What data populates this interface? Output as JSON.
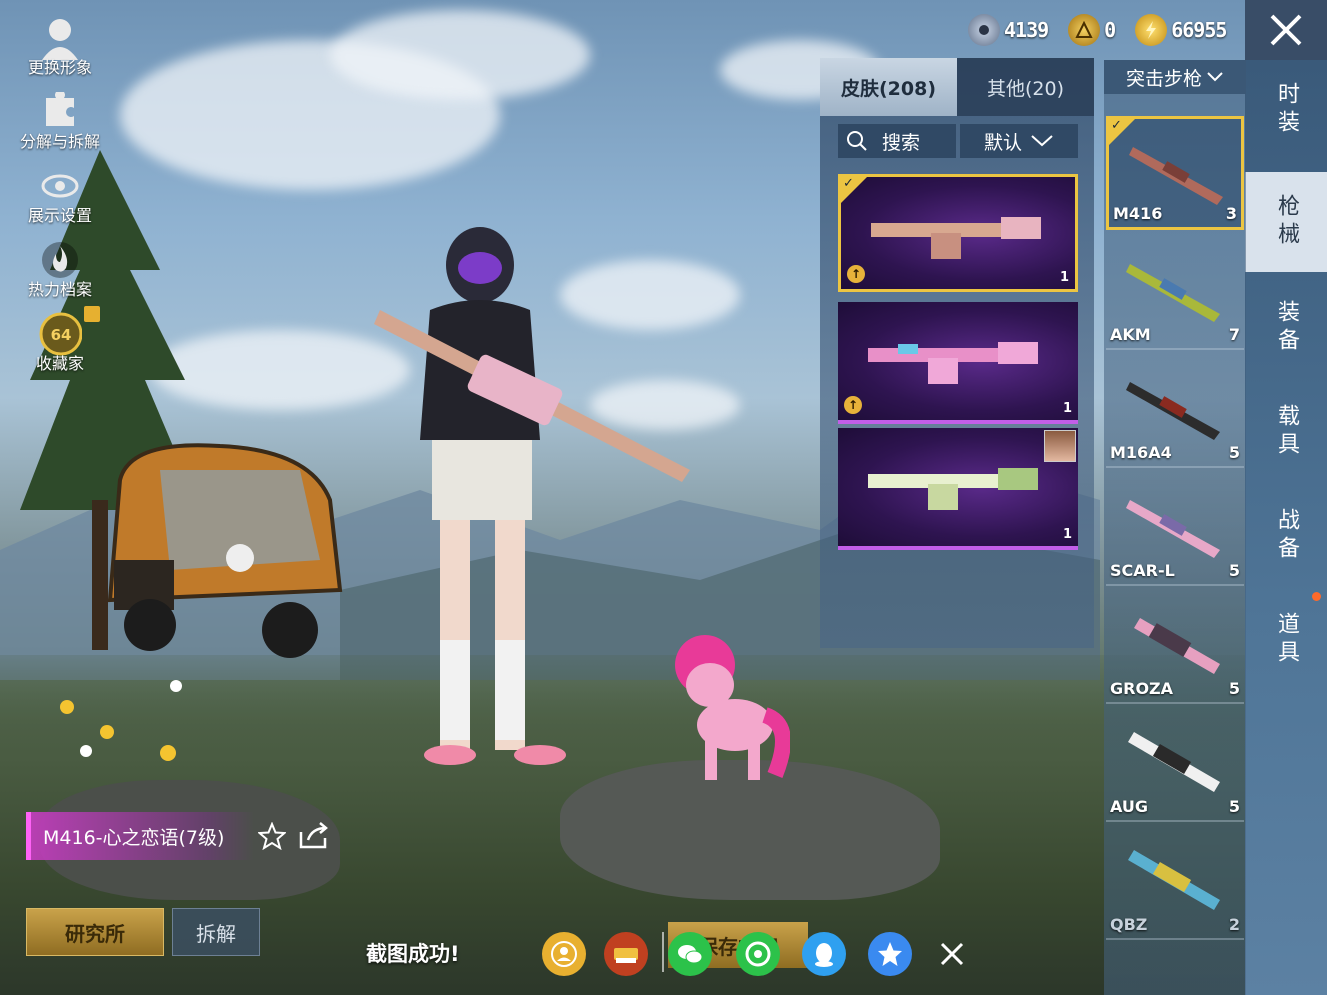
{
  "left_menu": [
    {
      "label": "更换形象",
      "icon": "avatar-icon"
    },
    {
      "label": "分解与拆解",
      "icon": "puzzle-icon"
    },
    {
      "label": "展示设置",
      "icon": "eye-icon"
    },
    {
      "label": "热力档案",
      "icon": "flame-icon"
    },
    {
      "label": "收藏家",
      "icon": "collector-badge-icon",
      "badge_level": "64"
    }
  ],
  "currency": [
    {
      "icon": "silver-coin-icon",
      "value": "4139",
      "color": "#8aa0c0"
    },
    {
      "icon": "gold-token-icon",
      "value": "0",
      "color": "#e0b030"
    },
    {
      "icon": "bp-coin-icon",
      "value": "66955",
      "color": "#f0c040"
    }
  ],
  "categories": [
    {
      "label": "时装",
      "active": false
    },
    {
      "label": "枪械",
      "active": true
    },
    {
      "label": "装备",
      "active": false
    },
    {
      "label": "载具",
      "active": false
    },
    {
      "label": "战备",
      "active": false
    },
    {
      "label": "道具",
      "active": false
    }
  ],
  "weapon_type_select": "突击步枪",
  "weapons": [
    {
      "name": "M416",
      "count": "3",
      "selected": true
    },
    {
      "name": "AKM",
      "count": "7",
      "selected": false
    },
    {
      "name": "M16A4",
      "count": "5",
      "selected": false
    },
    {
      "name": "SCAR-L",
      "count": "5",
      "selected": false
    },
    {
      "name": "GROZA",
      "count": "5",
      "selected": false
    },
    {
      "name": "AUG",
      "count": "5",
      "selected": false
    },
    {
      "name": "QBZ",
      "count": "2",
      "selected": false
    }
  ],
  "tabs": {
    "skins": "皮肤(208)",
    "other": "其他(20)"
  },
  "search": {
    "label": "搜索"
  },
  "sort": {
    "label": "默认"
  },
  "skins": [
    {
      "count": "1",
      "selected": true,
      "upgradeable": true
    },
    {
      "count": "1",
      "selected": false,
      "upgradeable": true
    },
    {
      "count": "1",
      "selected": false,
      "upgradeable": false
    }
  ],
  "item_name": "M416-心之恋语(7级)",
  "buttons": {
    "lab": "研究所",
    "disassemble": "拆解",
    "save": "保存方案"
  },
  "screenshot_msg": "截图成功!",
  "share_icons": [
    "peace-friend-icon",
    "peace-elite-icon",
    "wechat-icon",
    "moments-icon",
    "qq-icon",
    "qzone-icon",
    "close-share-icon"
  ]
}
